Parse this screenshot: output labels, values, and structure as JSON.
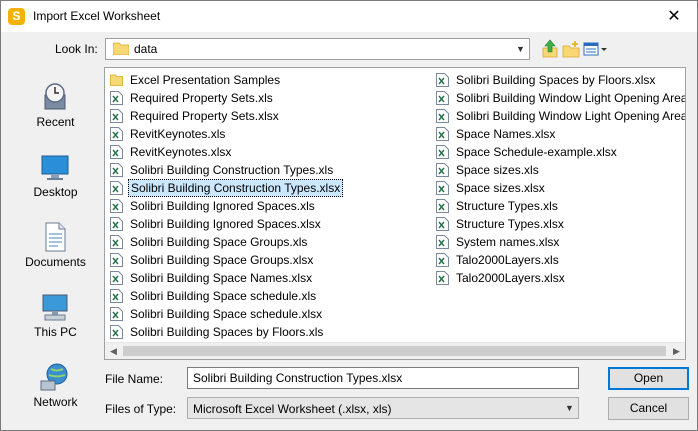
{
  "window": {
    "title": "Import Excel Worksheet",
    "app_icon_letter": "S",
    "close_glyph": "✕"
  },
  "lookin": {
    "label": "Look In:",
    "value": "data"
  },
  "places": [
    {
      "label": "Recent",
      "icon": "recent-icon"
    },
    {
      "label": "Desktop",
      "icon": "desktop-icon"
    },
    {
      "label": "Documents",
      "icon": "documents-icon"
    },
    {
      "label": "This PC",
      "icon": "computer-icon"
    },
    {
      "label": "Network",
      "icon": "network-icon"
    }
  ],
  "files_col1": [
    {
      "name": "Excel Presentation Samples",
      "type": "folder"
    },
    {
      "name": "Required Property Sets.xls",
      "type": "excel"
    },
    {
      "name": "Required Property Sets.xlsx",
      "type": "excel"
    },
    {
      "name": "RevitKeynotes.xls",
      "type": "excel"
    },
    {
      "name": "RevitKeynotes.xlsx",
      "type": "excel"
    },
    {
      "name": "Solibri Building Construction Types.xls",
      "type": "excel"
    },
    {
      "name": "Solibri Building Construction Types.xlsx",
      "type": "excel",
      "selected": true
    },
    {
      "name": "Solibri Building Ignored Spaces.xls",
      "type": "excel"
    },
    {
      "name": "Solibri Building Ignored Spaces.xlsx",
      "type": "excel"
    },
    {
      "name": "Solibri Building Space Groups.xls",
      "type": "excel"
    },
    {
      "name": "Solibri Building Space Groups.xlsx",
      "type": "excel"
    },
    {
      "name": "Solibri Building Space Names.xlsx",
      "type": "excel"
    },
    {
      "name": "Solibri Building Space schedule.xls",
      "type": "excel"
    },
    {
      "name": "Solibri Building Space schedule.xlsx",
      "type": "excel"
    },
    {
      "name": "Solibri Building Spaces by Floors.xls",
      "type": "excel"
    }
  ],
  "files_col2": [
    {
      "name": "Solibri Building Spaces by Floors.xlsx",
      "type": "excel"
    },
    {
      "name": "Solibri Building Window Light Opening Area",
      "type": "excel"
    },
    {
      "name": "Solibri Building Window Light Opening Area",
      "type": "excel"
    },
    {
      "name": "Space Names.xlsx",
      "type": "excel"
    },
    {
      "name": "Space Schedule-example.xlsx",
      "type": "excel"
    },
    {
      "name": "Space sizes.xls",
      "type": "excel"
    },
    {
      "name": "Space sizes.xlsx",
      "type": "excel"
    },
    {
      "name": "Structure Types.xls",
      "type": "excel"
    },
    {
      "name": "Structure Types.xlsx",
      "type": "excel"
    },
    {
      "name": "System names.xlsx",
      "type": "excel"
    },
    {
      "name": "Talo2000Layers.xls",
      "type": "excel"
    },
    {
      "name": "Talo2000Layers.xlsx",
      "type": "excel"
    }
  ],
  "filename": {
    "label": "File Name:",
    "value": "Solibri Building Construction Types.xlsx"
  },
  "filetype": {
    "label": "Files of Type:",
    "value": "Microsoft Excel Worksheet (.xlsx, xls)"
  },
  "buttons": {
    "open": "Open",
    "cancel": "Cancel"
  },
  "colors": {
    "selection": "#cce8ff",
    "folder": "#f8d775",
    "excel_green": "#1e7145",
    "accent": "#0078d7"
  }
}
